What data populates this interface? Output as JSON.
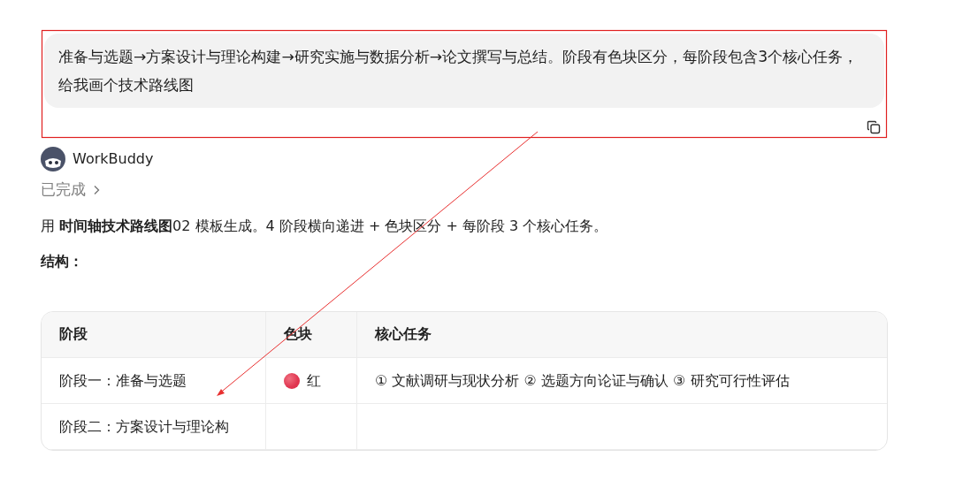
{
  "user_message": {
    "lines": [
      "准备与选题→方案设计与理论构建→研究实施与数据分析→论文撰写与总结。阶段有色块区分，每阶段包含3个核心任务，",
      "给我画个技术路线图"
    ]
  },
  "assistant": {
    "name": "WorkBuddy",
    "status": "已完成",
    "intro": "用 **时间轴技术路线图**02 模板生成。4 阶段横向递进 + 色块区分 + 每阶段 3 个核心任务。",
    "section_title": "结构："
  },
  "table": {
    "columns": [
      "阶段",
      "色块",
      "核心任务"
    ],
    "rows": [
      {
        "stage": "阶段一：准备与选题",
        "color": "#e0344f",
        "color_name": "红",
        "tasks": "① 文献调研与现状分析 ② 选题方向论证与确认 ③ 研究可行性评估"
      },
      {
        "stage": "阶段二：方案设计与理论构"
      }
    ]
  }
}
